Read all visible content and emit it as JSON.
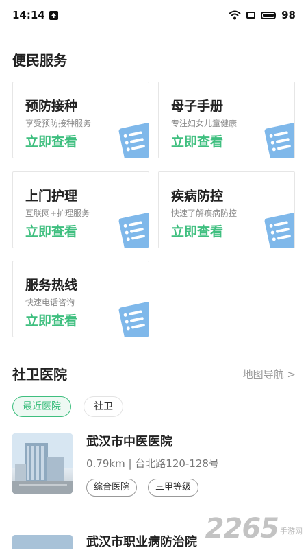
{
  "status_bar": {
    "time": "14:14",
    "battery": "98"
  },
  "services": {
    "title": "便民服务",
    "cards": [
      {
        "title": "预防接种",
        "subtitle": "享受预防接种服务",
        "action": "立即查看"
      },
      {
        "title": "母子手册",
        "subtitle": "专注妇女儿童健康",
        "action": "立即查看"
      },
      {
        "title": "上门护理",
        "subtitle": "互联网+护理服务",
        "action": "立即查看"
      },
      {
        "title": "疾病防控",
        "subtitle": "快速了解疾病防控",
        "action": "立即查看"
      },
      {
        "title": "服务热线",
        "subtitle": "快速电话咨询",
        "action": "立即查看"
      }
    ]
  },
  "hospitals": {
    "title": "社卫医院",
    "map_link": "地图导航 >",
    "filters": [
      "最近医院",
      "社卫"
    ],
    "items": [
      {
        "name": "武汉市中医医院",
        "address": "0.79km | 台北路120-128号",
        "tags": [
          "综合医院",
          "三甲等级"
        ]
      },
      {
        "name": "武汉市职业病防治院"
      }
    ]
  },
  "watermark": {
    "number": "2265",
    "site": "手游网"
  },
  "colors": {
    "accent": "#3fbf7f",
    "icon_blue": "#7fb8ea"
  }
}
